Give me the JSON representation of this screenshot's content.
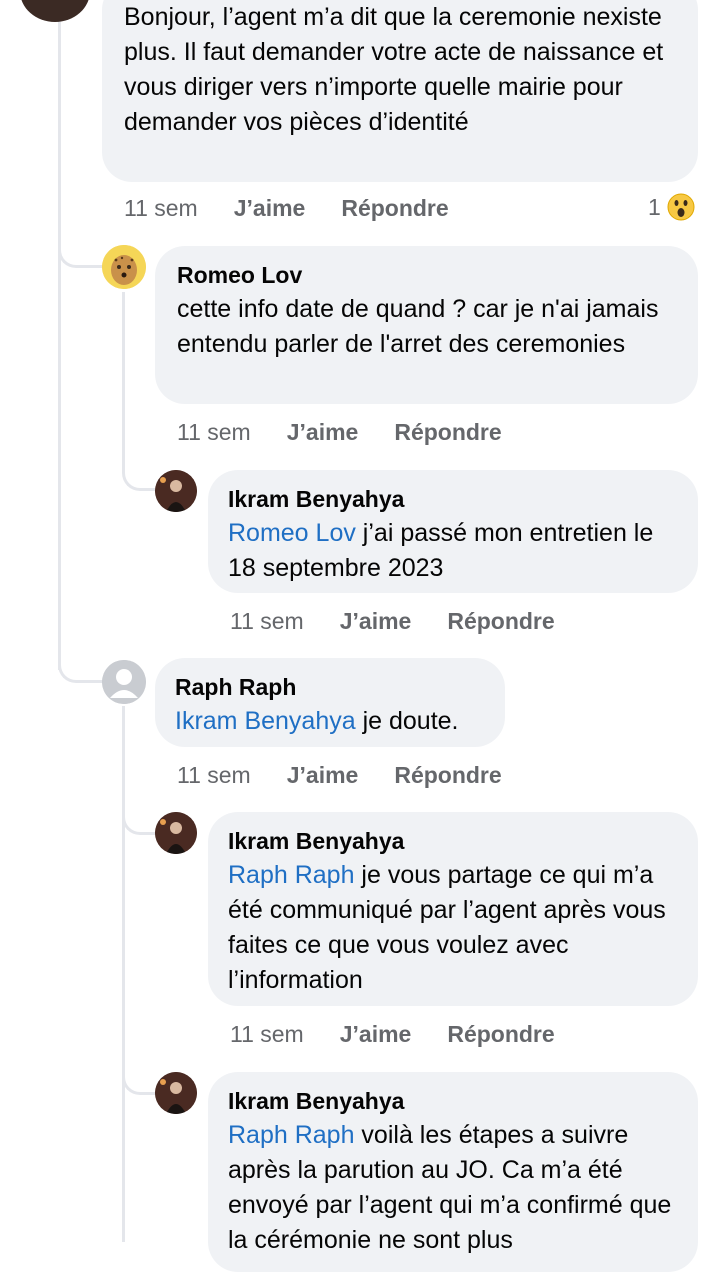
{
  "comments": [
    {
      "author": "",
      "text": "Bonjour, l’agent m’a dit que la ceremonie nexiste plus. Il faut demander votre acte de naissance et vous diriger vers n’importe quelle mairie pour demander vos pièces d’identité",
      "time": "11 sem",
      "like": "J’aime",
      "reply": "Répondre",
      "reaction_count": "1",
      "reaction_icon": "wow-emoji-icon"
    },
    {
      "author": "Romeo Lov",
      "text": "cette info date de quand ? car je n'ai jamais entendu parler de l'arret des ceremonies",
      "time": "11 sem",
      "like": "J’aime",
      "reply": "Répondre"
    },
    {
      "author": "Ikram Benyahya",
      "mention": "Romeo Lov",
      "text": " j’ai passé mon entretien le 18 septembre 2023",
      "time": "11 sem",
      "like": "J’aime",
      "reply": "Répondre"
    },
    {
      "author": "Raph Raph",
      "mention": "Ikram Benyahya",
      "text": " je doute.",
      "time": "11 sem",
      "like": "J’aime",
      "reply": "Répondre"
    },
    {
      "author": "Ikram Benyahya",
      "mention": "Raph Raph",
      "text": " je vous partage ce qui m’a été communiqué par l’agent après vous faites ce que vous voulez avec l’information",
      "time": "11 sem",
      "like": "J’aime",
      "reply": "Répondre"
    },
    {
      "author": "Ikram Benyahya",
      "mention": "Raph Raph",
      "text": " voilà les étapes a suivre après la parution au JO. Ca m’a été envoyé par l’agent qui m’a confirmé que la cérémonie ne sont plus"
    }
  ],
  "colors": {
    "bubble": "#f0f2f5",
    "mention": "#1f6fc4",
    "meta": "#65676b",
    "thread": "#e4e6eb"
  }
}
